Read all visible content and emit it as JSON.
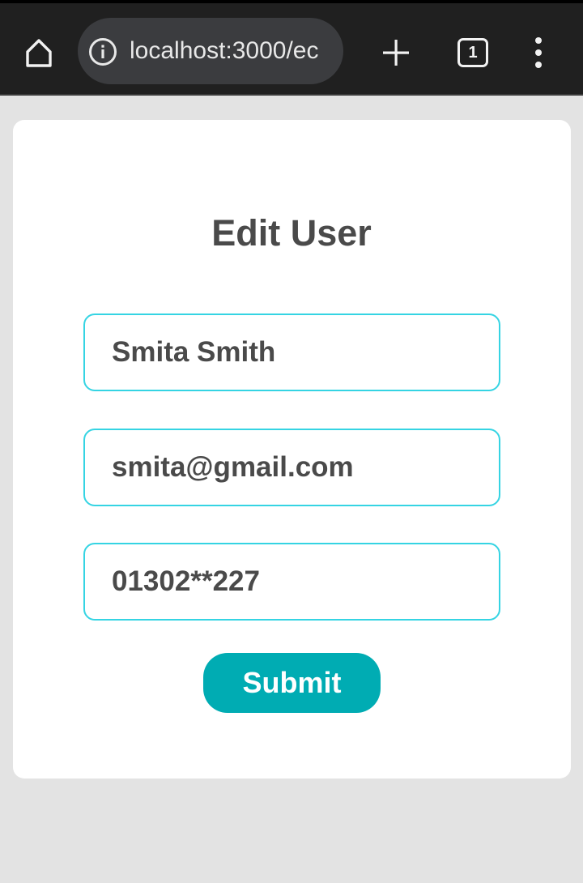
{
  "browser": {
    "url": "localhost:3000/ec",
    "tab_count": "1",
    "icons": {
      "home": "home-icon",
      "info": "info-icon",
      "new_tab": "plus-icon",
      "tabs": "tab-switcher-icon",
      "menu": "more-vert-icon"
    }
  },
  "form": {
    "title": "Edit User",
    "name_value": "Smita Smith",
    "email_value": "smita@gmail.com",
    "phone_value": "01302**227",
    "submit_label": "Submit"
  },
  "colors": {
    "field_border": "#35d4e3",
    "submit_bg": "#00acb3",
    "text": "#4a4a4a",
    "page_bg": "#e3e3e3",
    "toolbar_bg": "#202020"
  }
}
